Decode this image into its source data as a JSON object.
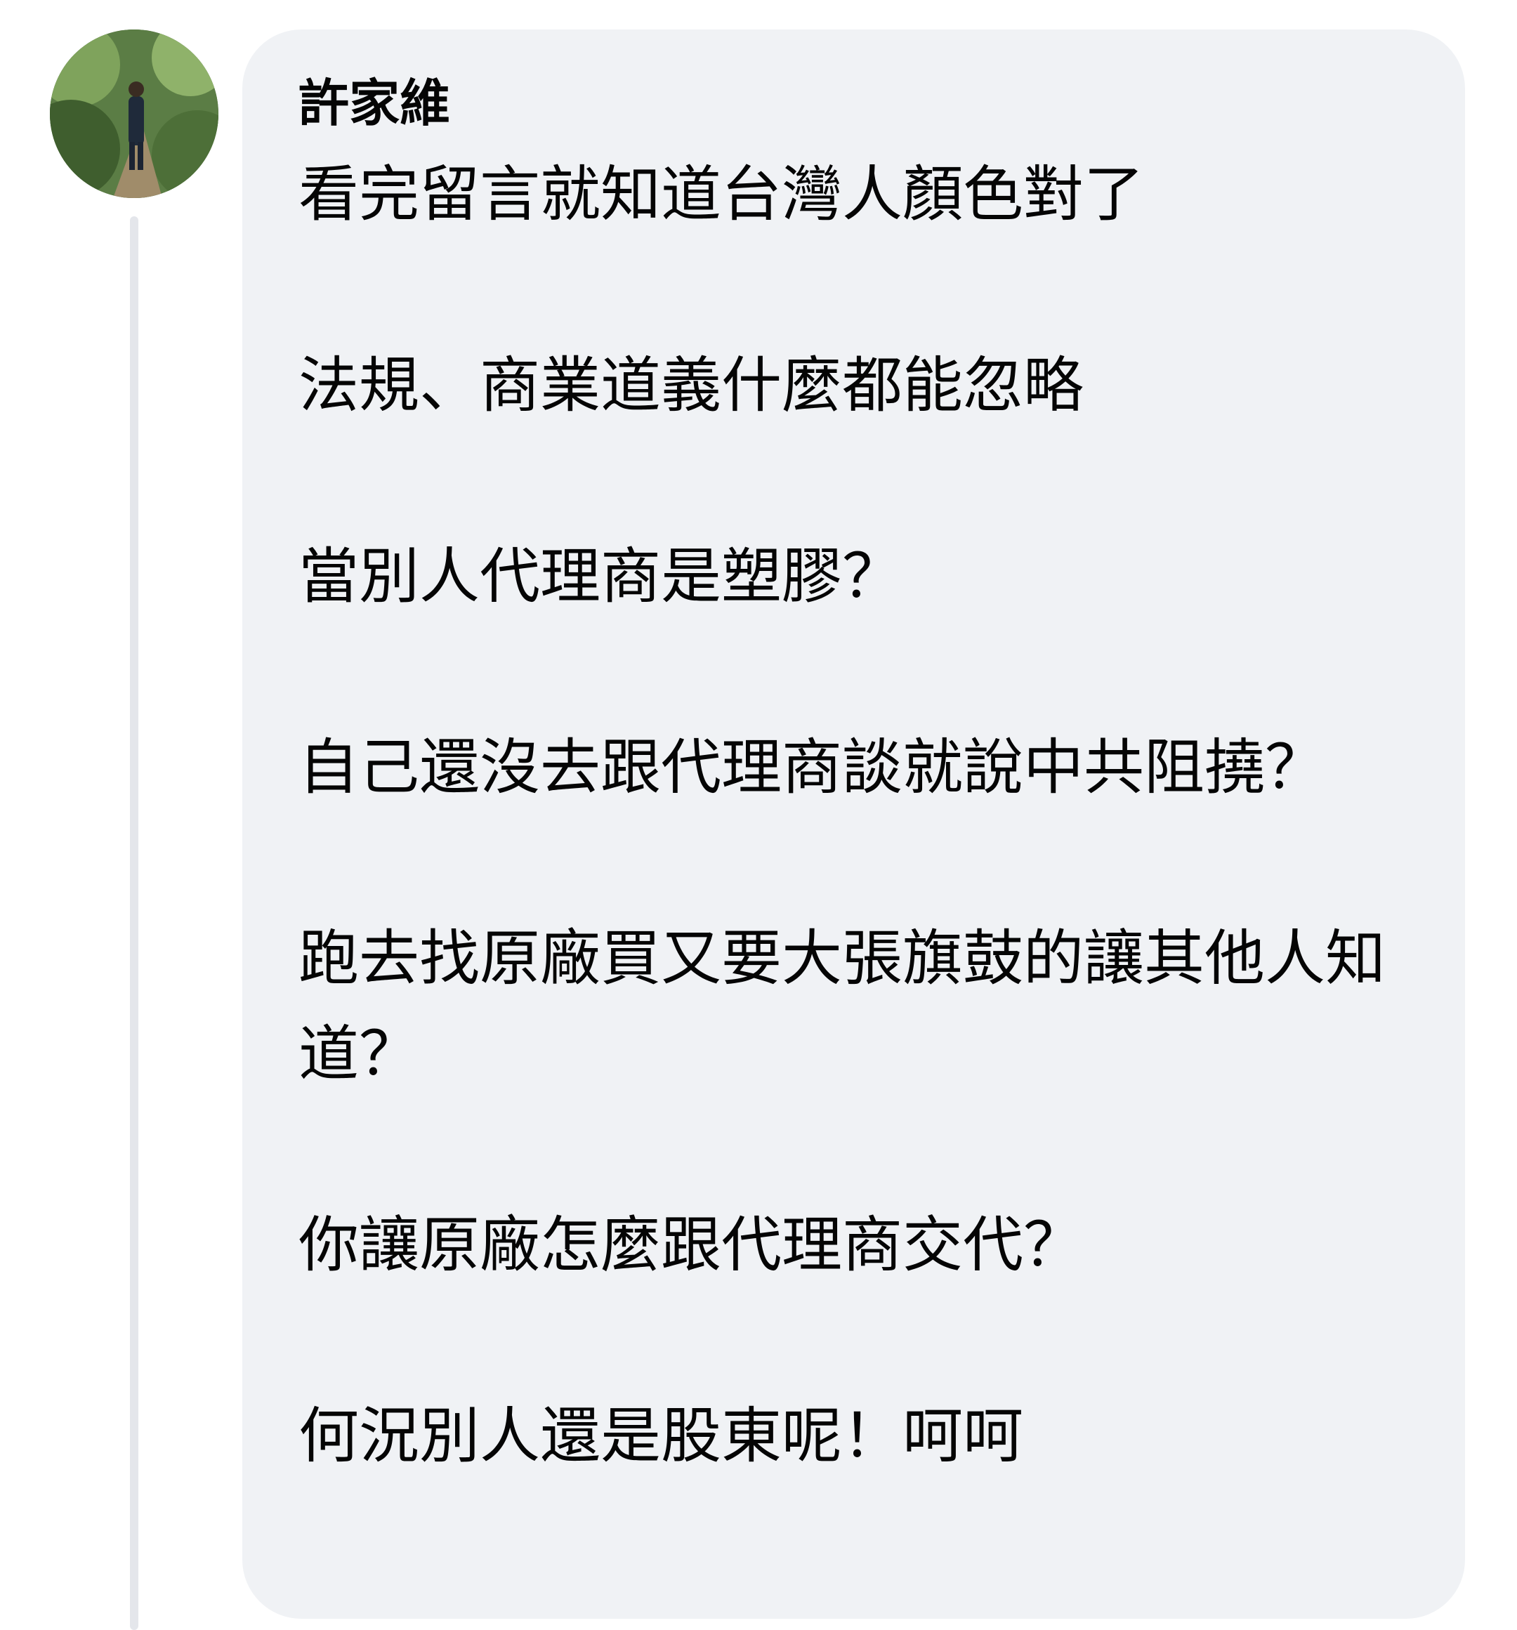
{
  "comment": {
    "author": "許家維",
    "paragraphs": [
      "看完留言就知道台灣人顏色對了",
      "法規、商業道義什麼都能忽略",
      "當別人代理商是塑膠？",
      "自己還沒去跟代理商談就說中共阻撓？",
      "跑去找原廠買又要大張旗鼓的讓其他人知道？",
      "你讓原廠怎麼跟代理商交代？",
      "何況別人還是股東呢！呵呵"
    ]
  },
  "colors": {
    "bubble_background": "#f0f2f5",
    "text": "#050505",
    "thread_line": "#e4e6eb"
  },
  "icons": {
    "avatar": "profile-photo-hiker-in-forest"
  }
}
